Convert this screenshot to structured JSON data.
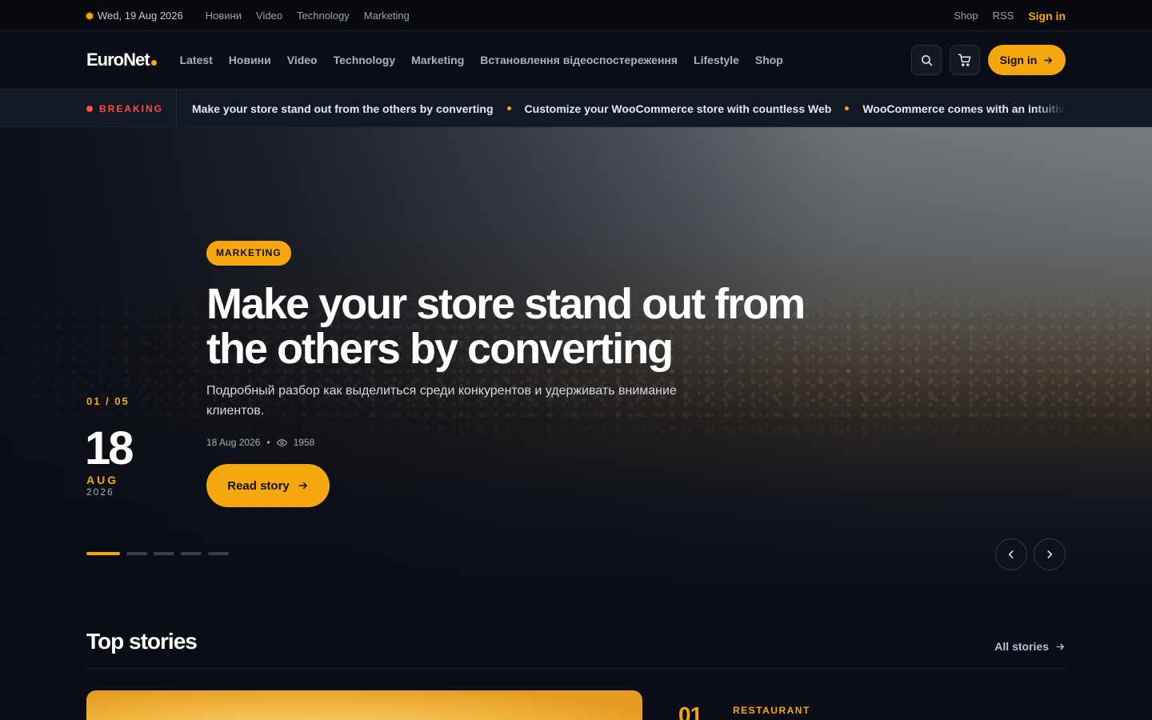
{
  "topbar": {
    "date": "Wed, 19 Aug 2026",
    "links": [
      "Новини",
      "Video",
      "Technology",
      "Marketing"
    ],
    "right_links": [
      "Shop",
      "RSS"
    ],
    "signin": "Sign in"
  },
  "header": {
    "logo": "EuroNet",
    "nav": [
      "Latest",
      "Новини",
      "Video",
      "Technology",
      "Marketing",
      "Встановлення відеоспостереження",
      "Lifestyle",
      "Shop"
    ],
    "signin_button": "Sign in"
  },
  "breaking": {
    "label": "BREAKING",
    "items": [
      "Make your store stand out from the others by converting",
      "Customize your WooCommerce store with countless Web",
      "WooCommerce comes with an intuitive drag-and-"
    ]
  },
  "hero": {
    "category": "MARKETING",
    "title": "Make your store stand out from the others by converting",
    "subtitle": "Подробный разбор как выделиться среди конкурентов и удерживать внимание клиентов.",
    "date": "18 Aug 2026",
    "views": "1958",
    "cta": "Read story",
    "slide_counter": "01 / 05",
    "day": "18",
    "month": "AUG",
    "year": "2026",
    "slides_total": 5,
    "active_slide": 1
  },
  "top_stories": {
    "title": "Top stories",
    "all_link": "All stories",
    "first_rank": "01",
    "first_category": "RESTAURANT"
  },
  "colors": {
    "accent": "#f5a70f",
    "breaking": "#ff4d3d",
    "background": "#0b0e16"
  }
}
